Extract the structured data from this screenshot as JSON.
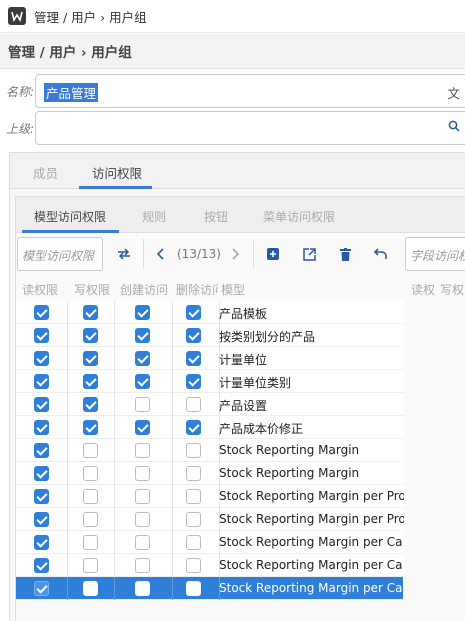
{
  "window": {
    "title": "管理 / 用户 › 用户组",
    "app_icon": "app-logo-icon"
  },
  "header": {
    "breadcrumb": "管理 / 用户 › 用户组"
  },
  "form": {
    "name_label": "名称:",
    "name_value": "产品管理",
    "name_icon_text": "文",
    "parent_label": "上级:",
    "parent_value": "",
    "parent_icon": "search-icon"
  },
  "tabs": [
    "成员",
    "访问权限"
  ],
  "active_tab": "访问权限",
  "subtabs": [
    "模型访问权限",
    "规则",
    "按钮",
    "菜单访问权限"
  ],
  "active_subtab": "模型访问权限",
  "toolbar": {
    "model_filter_placeholder": "模型访问权限",
    "counter": "(13/13)",
    "field_filter_placeholder": "字段访问权限",
    "buttons": [
      "swap-icon",
      "prev-icon",
      "next-icon",
      "add-icon",
      "open-icon",
      "delete-icon",
      "undo-icon"
    ]
  },
  "columns": [
    "读权限",
    "写权限",
    "创建访问",
    "删除访问",
    "模型"
  ],
  "right_columns": [
    "读权",
    "写权"
  ],
  "rows": [
    {
      "read": true,
      "write": true,
      "create": true,
      "delete": true,
      "model": "产品模板"
    },
    {
      "read": true,
      "write": true,
      "create": true,
      "delete": true,
      "model": "按类别划分的产品"
    },
    {
      "read": true,
      "write": true,
      "create": true,
      "delete": true,
      "model": "计量单位"
    },
    {
      "read": true,
      "write": true,
      "create": true,
      "delete": true,
      "model": "计量单位类别"
    },
    {
      "read": true,
      "write": true,
      "create": false,
      "delete": false,
      "model": "产品设置"
    },
    {
      "read": true,
      "write": true,
      "create": true,
      "delete": true,
      "model": "产品成本价修正"
    },
    {
      "read": true,
      "write": false,
      "create": false,
      "delete": false,
      "model": "Stock Reporting Margin"
    },
    {
      "read": true,
      "write": false,
      "create": false,
      "delete": false,
      "model": "Stock Reporting Margin"
    },
    {
      "read": true,
      "write": false,
      "create": false,
      "delete": false,
      "model": "Stock Reporting Margin per Pro"
    },
    {
      "read": true,
      "write": false,
      "create": false,
      "delete": false,
      "model": "Stock Reporting Margin per Pro"
    },
    {
      "read": true,
      "write": false,
      "create": false,
      "delete": false,
      "model": "Stock Reporting Margin per Ca"
    },
    {
      "read": true,
      "write": false,
      "create": false,
      "delete": false,
      "model": "Stock Reporting Margin per Ca"
    },
    {
      "read": true,
      "write": false,
      "create": false,
      "delete": false,
      "model": "Stock Reporting Margin per Ca",
      "selected": true
    }
  ],
  "colors": {
    "accent": "#2f7ed8",
    "selected_row": "#2f7ed8"
  }
}
